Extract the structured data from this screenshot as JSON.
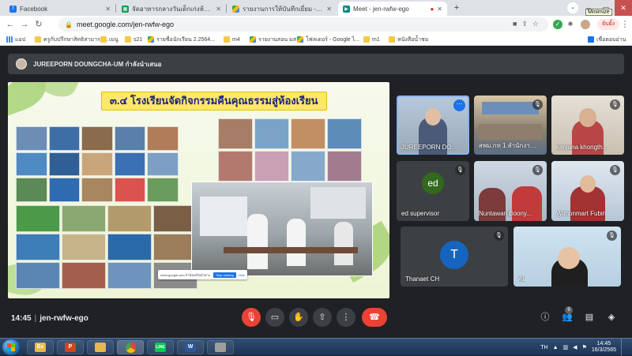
{
  "browser": {
    "tabs": [
      {
        "label": "Facebook",
        "favicon_color": "#1877f2",
        "icon": "facebook-icon"
      },
      {
        "label": "จัดอาหารกลางวันเด็กเก่งห้องเรียน ม.ต้น",
        "favicon_color": "#0f9d58",
        "icon": "sheets-icon"
      },
      {
        "label": "รายงานการให้บันทึกเยี่ยม - Google Drive",
        "favicon_color": "#fbbc04",
        "icon": "drive-icon"
      },
      {
        "label": "Meet - jen-rwfw-ego",
        "favicon_color": "#00897b",
        "icon": "meet-icon"
      }
    ],
    "tooltip": "Minimize",
    "url": "meet.google.com/jen-rwfw-ego",
    "pause_label": "ยับยั้ง",
    "bookmarks": [
      {
        "label": "แอป",
        "icon": "apps-grid-icon"
      },
      {
        "label": "ครูกับปรึกษาสิทธิสามารถ...",
        "icon": "folder-icon"
      },
      {
        "label": "เมนู",
        "icon": "folder-icon"
      },
      {
        "label": "s21",
        "icon": "folder-icon"
      },
      {
        "label": "รายชื่อนักเรียน 2.2564...",
        "icon": "drive-icon"
      },
      {
        "label": "m4",
        "icon": "folder-icon"
      },
      {
        "label": "รายงานสอน มส",
        "icon": "drive-icon"
      },
      {
        "label": "โฟลเดอร์ - Google ไ...",
        "icon": "drive-icon"
      },
      {
        "label": "m1",
        "icon": "folder-icon"
      },
      {
        "label": "หนังสือน้ำชม",
        "icon": "folder-icon"
      }
    ],
    "other_bookmarks": "เชื่อตอบอ่าน"
  },
  "meet": {
    "presenter_text": "JUREEPORN DOUNGCHA-UM กำลังนำเสนอ",
    "slide": {
      "title": "๓.๔ โรงเรียนจัดกิจกรรมคืนคุณธรรมสู่ห้องเรียน",
      "share_banner_text": "meet.google.com กำลังแชร์หน้าต่าง",
      "share_stop": "Stop sharing",
      "share_hide": "Hide"
    },
    "participants": [
      {
        "name": "JUREEPORN DO...",
        "type": "video",
        "speaking": true
      },
      {
        "name": "สพม.กท 1 สำนักงา...",
        "type": "video",
        "speaking": false
      },
      {
        "name": "kanjana khongth...",
        "type": "video",
        "speaking": false
      },
      {
        "name": "ed supervisor",
        "type": "initial",
        "initial": "ed",
        "color": "#33691e"
      },
      {
        "name": "Nuntawan Boony...",
        "type": "video",
        "speaking": false
      },
      {
        "name": "Wimonmart Fubin",
        "type": "video",
        "speaking": false
      },
      {
        "name": "Thanaet CH",
        "type": "initial",
        "initial": "T",
        "color": "#1565c0"
      },
      {
        "name": "Ali",
        "type": "video",
        "speaking": false
      }
    ],
    "time": "14:45",
    "meeting_code": "jen-rwfw-ego",
    "people_count": "9"
  },
  "taskbar": {
    "apps": [
      {
        "label": "Ex",
        "icon": "file-explorer-icon",
        "color": "#e8b84a"
      },
      {
        "label": "P",
        "icon": "powerpoint-icon",
        "color": "#d04423"
      },
      {
        "label": "",
        "icon": "folder-icon",
        "color": "#e8b84a"
      },
      {
        "label": "",
        "icon": "chrome-icon",
        "color": "#4285f4"
      },
      {
        "label": "LINE",
        "icon": "line-icon",
        "color": "#06c755"
      },
      {
        "label": "W",
        "icon": "word-icon",
        "color": "#2b579a"
      },
      {
        "label": "",
        "icon": "paint-icon",
        "color": "#9e9e9e"
      }
    ],
    "lang": "TH",
    "clock_time": "14:45",
    "clock_date": "16/3/2565"
  }
}
